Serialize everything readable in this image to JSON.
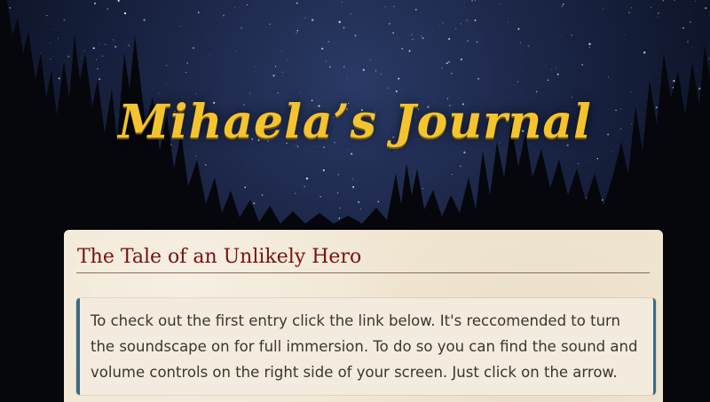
{
  "header": {
    "site_title": "Mihaela’s Journal"
  },
  "intro_panel": {
    "title": "The Tale of an Unlikely Hero",
    "note_text": "To check out the first entry click the link below. It's reccomended to turn the soundscape on for full immersion. To do so you can find the sound and volume controls on the right side of your screen. Just click on the arrow."
  },
  "colors": {
    "title_gold": "#f4c430",
    "panel_title_red": "#7a1010",
    "note_border_blue": "#3f6a84",
    "parchment": "#f1e7d4"
  }
}
